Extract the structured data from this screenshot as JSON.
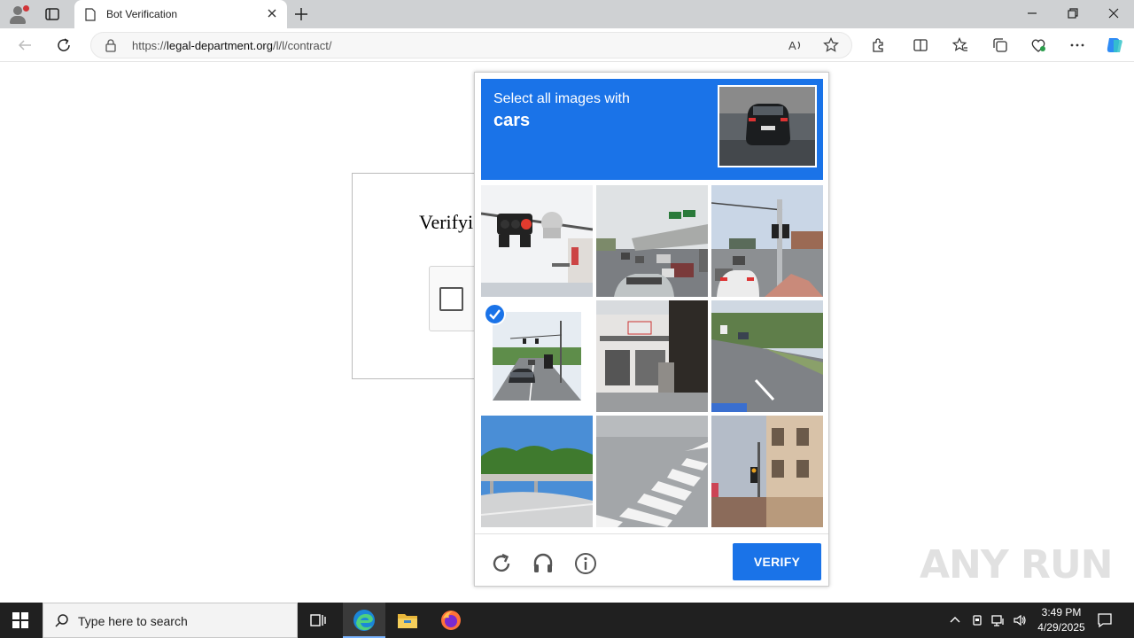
{
  "browser": {
    "tab_title": "Bot Verification",
    "url_domain": "legal-department.org",
    "url_path": "/l/l/contract/",
    "url_scheme": "https://"
  },
  "page": {
    "heading_partial": "Verifyi"
  },
  "challenge": {
    "instruction": "Select all images with",
    "target": "cars",
    "verify_label": "VERIFY",
    "tiles": [
      {
        "scene": "traffic-light",
        "selected": false
      },
      {
        "scene": "highway-traffic",
        "selected": false
      },
      {
        "scene": "intersection-cars",
        "selected": false
      },
      {
        "scene": "road-cars",
        "selected": true
      },
      {
        "scene": "storefront",
        "selected": false
      },
      {
        "scene": "road-car",
        "selected": false
      },
      {
        "scene": "bridge-trees",
        "selected": false
      },
      {
        "scene": "crosswalk",
        "selected": false
      },
      {
        "scene": "building-traffic-light",
        "selected": false
      }
    ],
    "accent_color": "#1a73e8"
  },
  "watermark": "ANY RUN",
  "taskbar": {
    "search_placeholder": "Type here to search",
    "time": "3:49 PM",
    "date": "4/29/2025"
  }
}
